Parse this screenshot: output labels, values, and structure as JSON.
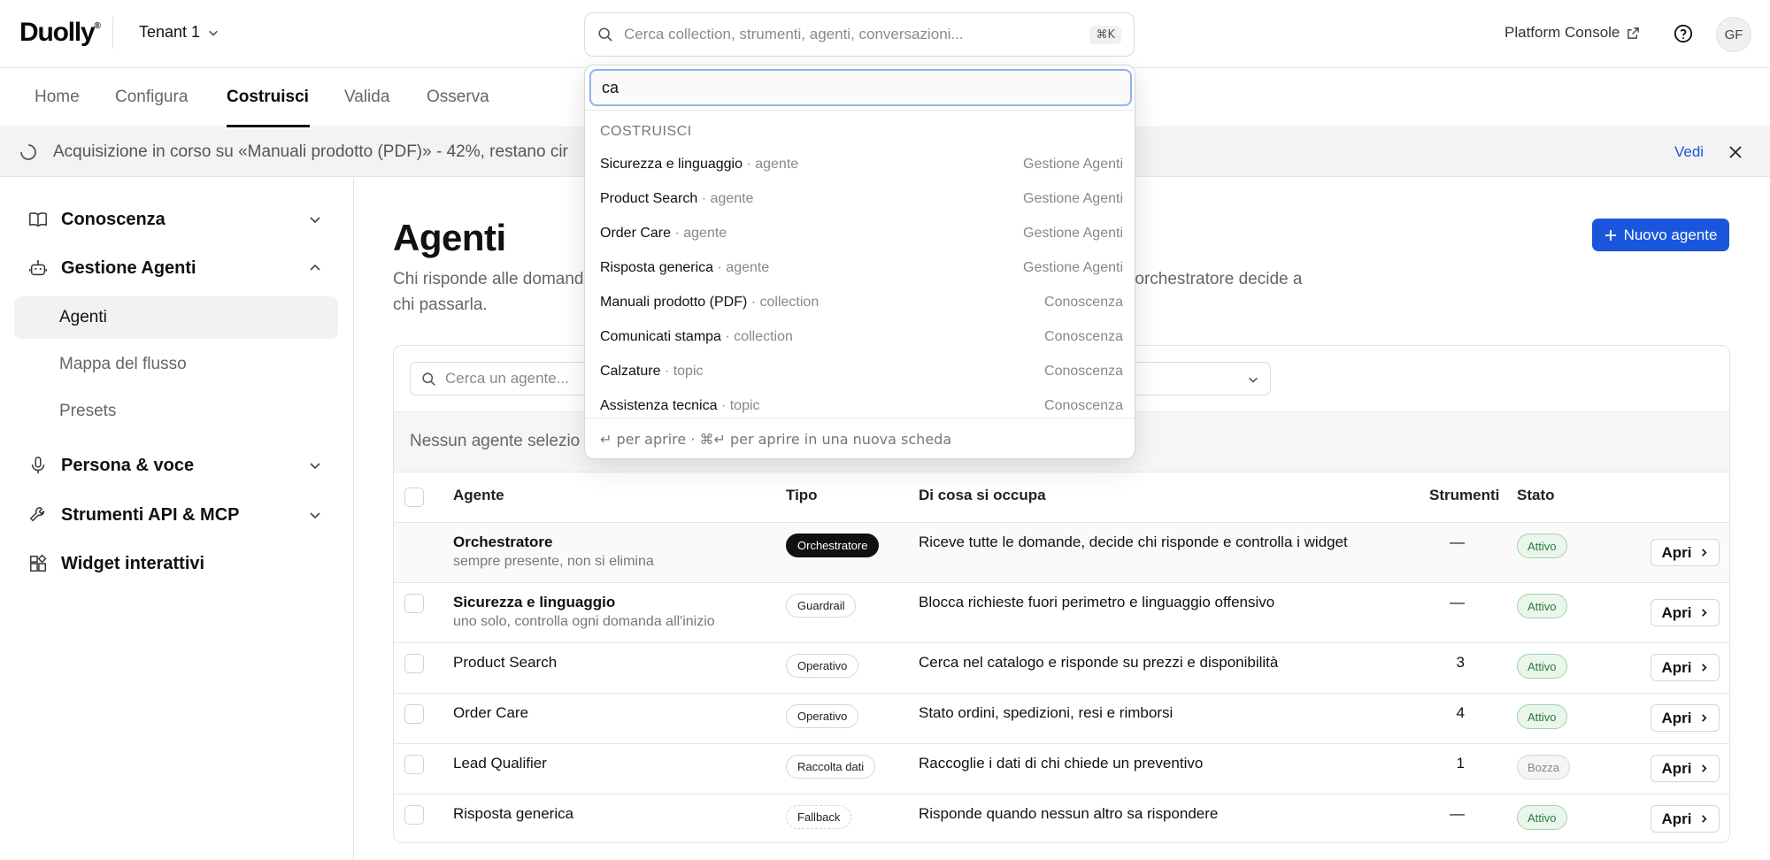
{
  "header": {
    "logo": "Duolly",
    "logo_mark": "®",
    "tenant": "Tenant 1",
    "search_placeholder": "Cerca collection, strumenti, agenti, conversazioni...",
    "search_shortcut": "⌘K",
    "platform_console": "Platform Console",
    "user_initials": "GF"
  },
  "tabs": [
    "Home",
    "Configura",
    "Costruisci",
    "Valida",
    "Osserva"
  ],
  "banner": {
    "text": "Acquisizione in corso su «Manuali prodotto (PDF)» - 42%, restano cir",
    "action": "Vedi"
  },
  "sidebar": {
    "groups": {
      "conoscenza": "Conoscenza",
      "gestione_agenti": "Gestione Agenti",
      "persona_voce": "Persona & voce",
      "strumenti": "Strumenti API & MCP",
      "widget": "Widget interattivi"
    },
    "items": {
      "agenti": "Agenti",
      "mappa": "Mappa del flusso",
      "presets": "Presets"
    }
  },
  "main": {
    "title": "Agenti",
    "description_line1": "Chi risponde alle domand",
    "description_line1_tail": "i l'orchestratore decide a",
    "description_line2": "chi passarla.",
    "new_button": "Nuovo agente",
    "search_placeholder": "Cerca un agente...",
    "selection_text": "Nessun agente selezio",
    "columns": {
      "agente": "Agente",
      "tipo": "Tipo",
      "compito": "Di cosa si occupa",
      "strumenti": "Strumenti",
      "stato": "Stato"
    },
    "open_label": "Apri",
    "rows": [
      {
        "name": "Orchestratore",
        "sub": "sempre presente, non si elimina",
        "type": "Orchestratore",
        "desc": "Riceve tutte le domande, decide chi risponde e controlla i widget",
        "tools": "—",
        "status": "Attivo"
      },
      {
        "name": "Sicurezza e linguaggio",
        "sub": "uno solo, controlla ogni domanda all'inizio",
        "type": "Guardrail",
        "desc": "Blocca richieste fuori perimetro e linguaggio offensivo",
        "tools": "—",
        "status": "Attivo"
      },
      {
        "name": "Product Search",
        "sub": "",
        "type": "Operativo",
        "desc": "Cerca nel catalogo e risponde su prezzi e disponibilità",
        "tools": "3",
        "status": "Attivo"
      },
      {
        "name": "Order Care",
        "sub": "",
        "type": "Operativo",
        "desc": "Stato ordini, spedizioni, resi e rimborsi",
        "tools": "4",
        "status": "Attivo"
      },
      {
        "name": "Lead Qualifier",
        "sub": "",
        "type": "Raccolta dati",
        "desc": "Raccoglie i dati di chi chiede un preventivo",
        "tools": "1",
        "status": "Bozza"
      },
      {
        "name": "Risposta generica",
        "sub": "",
        "type": "Fallback",
        "desc": "Risponde quando nessun altro sa rispondere",
        "tools": "—",
        "status": "Attivo"
      }
    ]
  },
  "palette": {
    "query": "ca",
    "group": "COSTRUISCI",
    "results": [
      {
        "name": "Sicurezza e linguaggio",
        "kind": " · agente",
        "category": "Gestione Agenti"
      },
      {
        "name": "Product Search",
        "kind": " · agente",
        "category": "Gestione Agenti"
      },
      {
        "name": "Order Care",
        "kind": " · agente",
        "category": "Gestione Agenti"
      },
      {
        "name": "Risposta generica",
        "kind": " · agente",
        "category": "Gestione Agenti"
      },
      {
        "name": "Manuali prodotto (PDF)",
        "kind": " · collection",
        "category": "Conoscenza"
      },
      {
        "name": "Comunicati stampa",
        "kind": " · collection",
        "category": "Conoscenza"
      },
      {
        "name": "Calzature",
        "kind": " · topic",
        "category": "Conoscenza"
      },
      {
        "name": "Assistenza tecnica",
        "kind": " · topic",
        "category": "Conoscenza"
      }
    ],
    "footer": "↵ per aprire · ⌘↵ per aprire in una nuova scheda"
  },
  "colors": {
    "accent": "#1a56db",
    "status_active_bg": "#eaf6ec",
    "status_active_text": "#2b7a3b"
  }
}
